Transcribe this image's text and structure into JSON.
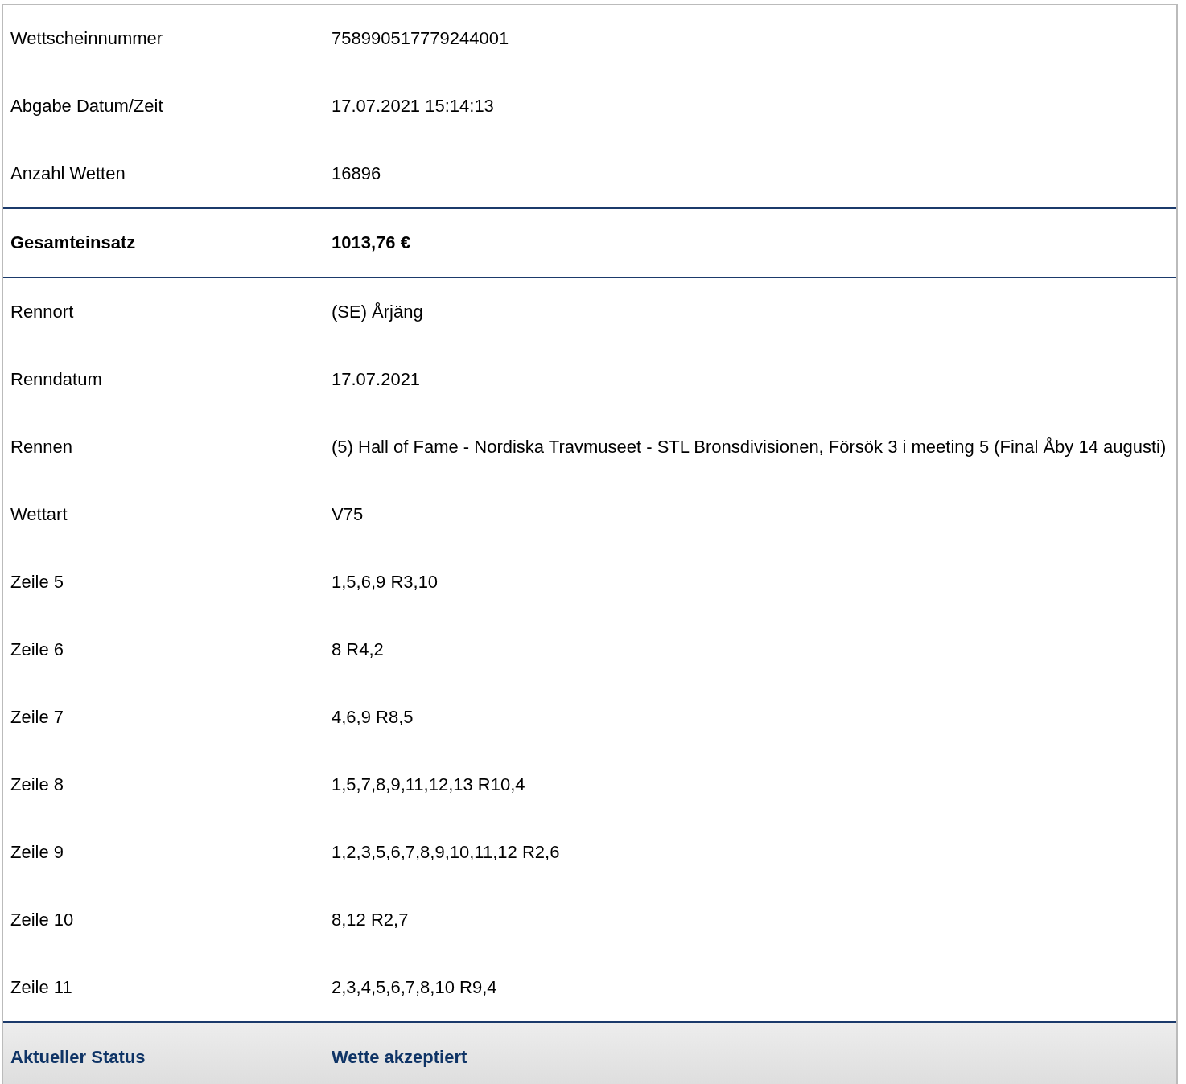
{
  "rows": [
    {
      "kind": "normal",
      "label": "Wettscheinnummer",
      "value": "758990517779244001"
    },
    {
      "kind": "normal",
      "label": "Abgabe Datum/Zeit",
      "value": "17.07.2021 15:14:13"
    },
    {
      "kind": "normal",
      "label": "Anzahl Wetten",
      "value": "16896"
    },
    {
      "kind": "total",
      "label": "Gesamteinsatz",
      "value": "1013,76 €"
    },
    {
      "kind": "normal",
      "label": "Rennort",
      "value": "(SE) Årjäng"
    },
    {
      "kind": "normal",
      "label": "Renndatum",
      "value": "17.07.2021"
    },
    {
      "kind": "normal",
      "label": "Rennen",
      "value": "(5) Hall of Fame - Nordiska Travmuseet - STL Bronsdivisionen, Försök 3 i meeting 5 (Final Åby 14 augusti)"
    },
    {
      "kind": "normal",
      "label": "Wettart",
      "value": "V75"
    },
    {
      "kind": "normal",
      "label": "Zeile 5",
      "value": "1,5,6,9 R3,10"
    },
    {
      "kind": "normal",
      "label": "Zeile 6",
      "value": "8 R4,2"
    },
    {
      "kind": "normal",
      "label": "Zeile 7",
      "value": "4,6,9 R8,5"
    },
    {
      "kind": "normal",
      "label": "Zeile 8",
      "value": "1,5,7,8,9,11,12,13 R10,4"
    },
    {
      "kind": "normal",
      "label": "Zeile 9",
      "value": "1,2,3,5,6,7,8,9,10,11,12 R2,6"
    },
    {
      "kind": "normal",
      "label": "Zeile 10",
      "value": "8,12 R2,7"
    },
    {
      "kind": "normal",
      "label": "Zeile 11",
      "value": "2,3,4,5,6,7,8,10 R9,4"
    },
    {
      "kind": "status",
      "label": "Aktueller Status",
      "value": "Wette akzeptiert"
    }
  ]
}
